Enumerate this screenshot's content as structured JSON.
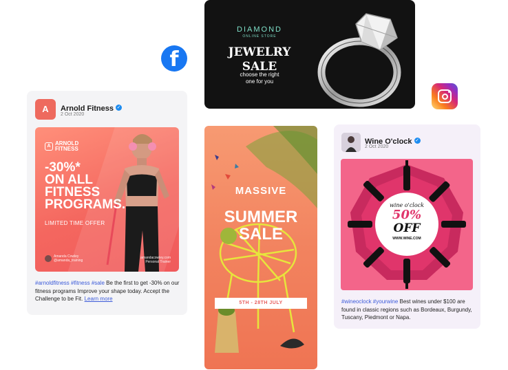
{
  "icons": {
    "facebook": "facebook-icon",
    "instagram": "instagram-icon"
  },
  "jewelry": {
    "brand": "DIAMOND",
    "brand_sub": "ONLINE STORE",
    "headline_line1": "JEWELRY",
    "headline_line2": "SALE",
    "tagline_line1": "choose the right",
    "tagline_line2": "one for you"
  },
  "fitness_post": {
    "name": "Arnold Fitness",
    "date": "2 Oct 2020",
    "logo_line1": "ARNOLD",
    "logo_line2": "FITNESS",
    "headline": [
      "-30%*",
      "ON ALL",
      "FITNESS",
      "PROGRAMS."
    ],
    "offer": "LIMITED TIME OFFER",
    "user_name": "Amanda Cowley",
    "user_handle": "@amanda_training",
    "contact_site": "amandacowley.com",
    "contact_role": "Personal Trainer",
    "hashtags": "#arnoldfitness #fitness #sale",
    "body": " Be the first to get -30% on our fitness programs Improve your shape today. Accept the Challenge to be Fit. ",
    "link": "Learn more"
  },
  "summer": {
    "line1": "MASSIVE",
    "line2": "SUMMER",
    "line3": "SALE",
    "dates": "5TH - 28TH  JULY"
  },
  "wine_post": {
    "name": "Wine O'clock",
    "date": "2 Oct 2020",
    "img_title": "wine o'clock",
    "img_discount": "50%",
    "img_off": "OFF",
    "img_site": "WWW.WINE.COM",
    "hashtags": "#wineoclock #yourwine",
    "body": " Best wines under $100 are found in classic regions such as Bordeaux, Burgundy, Tuscany, Piedmont or Napa."
  },
  "colors": {
    "facebook": "#1877f2",
    "fitness_accent": "#ee6a5e",
    "hashtag": "#3b5ad9",
    "summer_bg": "#f2835f",
    "wine_pink": "#f3658a",
    "jewelry_bg": "#121212",
    "jewelry_brand": "#7fe0c9"
  }
}
